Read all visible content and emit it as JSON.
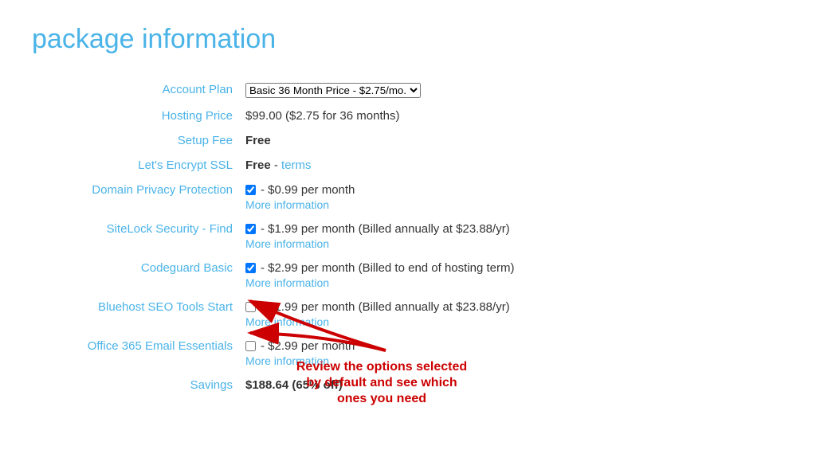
{
  "page": {
    "title": "package information"
  },
  "table": {
    "rows": [
      {
        "label": "Account Plan",
        "type": "select",
        "select_value": "Basic 36 Month Price - $2.75/mo.",
        "select_options": [
          "Basic 36 Month Price - $2.75/mo."
        ]
      },
      {
        "label": "Hosting Price",
        "type": "text",
        "value": "$99.00 ($2.75 for 36 months)"
      },
      {
        "label": "Setup Fee",
        "type": "text_bold",
        "value": "Free"
      },
      {
        "label": "Let's Encrypt SSL",
        "type": "text_with_link",
        "value": "Free",
        "link_text": "terms"
      },
      {
        "label": "Domain Privacy Protection",
        "type": "checkbox",
        "checked": true,
        "value": "- $0.99 per month",
        "more_info": "More information"
      },
      {
        "label": "SiteLock Security - Find",
        "type": "checkbox",
        "checked": true,
        "value": "- $1.99 per month (Billed annually at $23.88/yr)",
        "more_info": "More information"
      },
      {
        "label": "Codeguard Basic",
        "type": "checkbox",
        "checked": true,
        "value": "- $2.99 per month (Billed to end of hosting term)",
        "more_info": "More information"
      },
      {
        "label": "Bluehost SEO Tools Start",
        "type": "checkbox",
        "checked": false,
        "value": "- $1.99 per month (Billed annually at $23.88/yr)",
        "more_info": "More information"
      },
      {
        "label": "Office 365 Email Essentials",
        "type": "checkbox",
        "checked": false,
        "value": "- $2.99 per month",
        "more_info": "More information"
      },
      {
        "label": "Savings",
        "type": "text_bold",
        "value": "$188.64 (65% off)"
      }
    ],
    "review_annotation": "Review the options selected by default and see which ones you need"
  }
}
